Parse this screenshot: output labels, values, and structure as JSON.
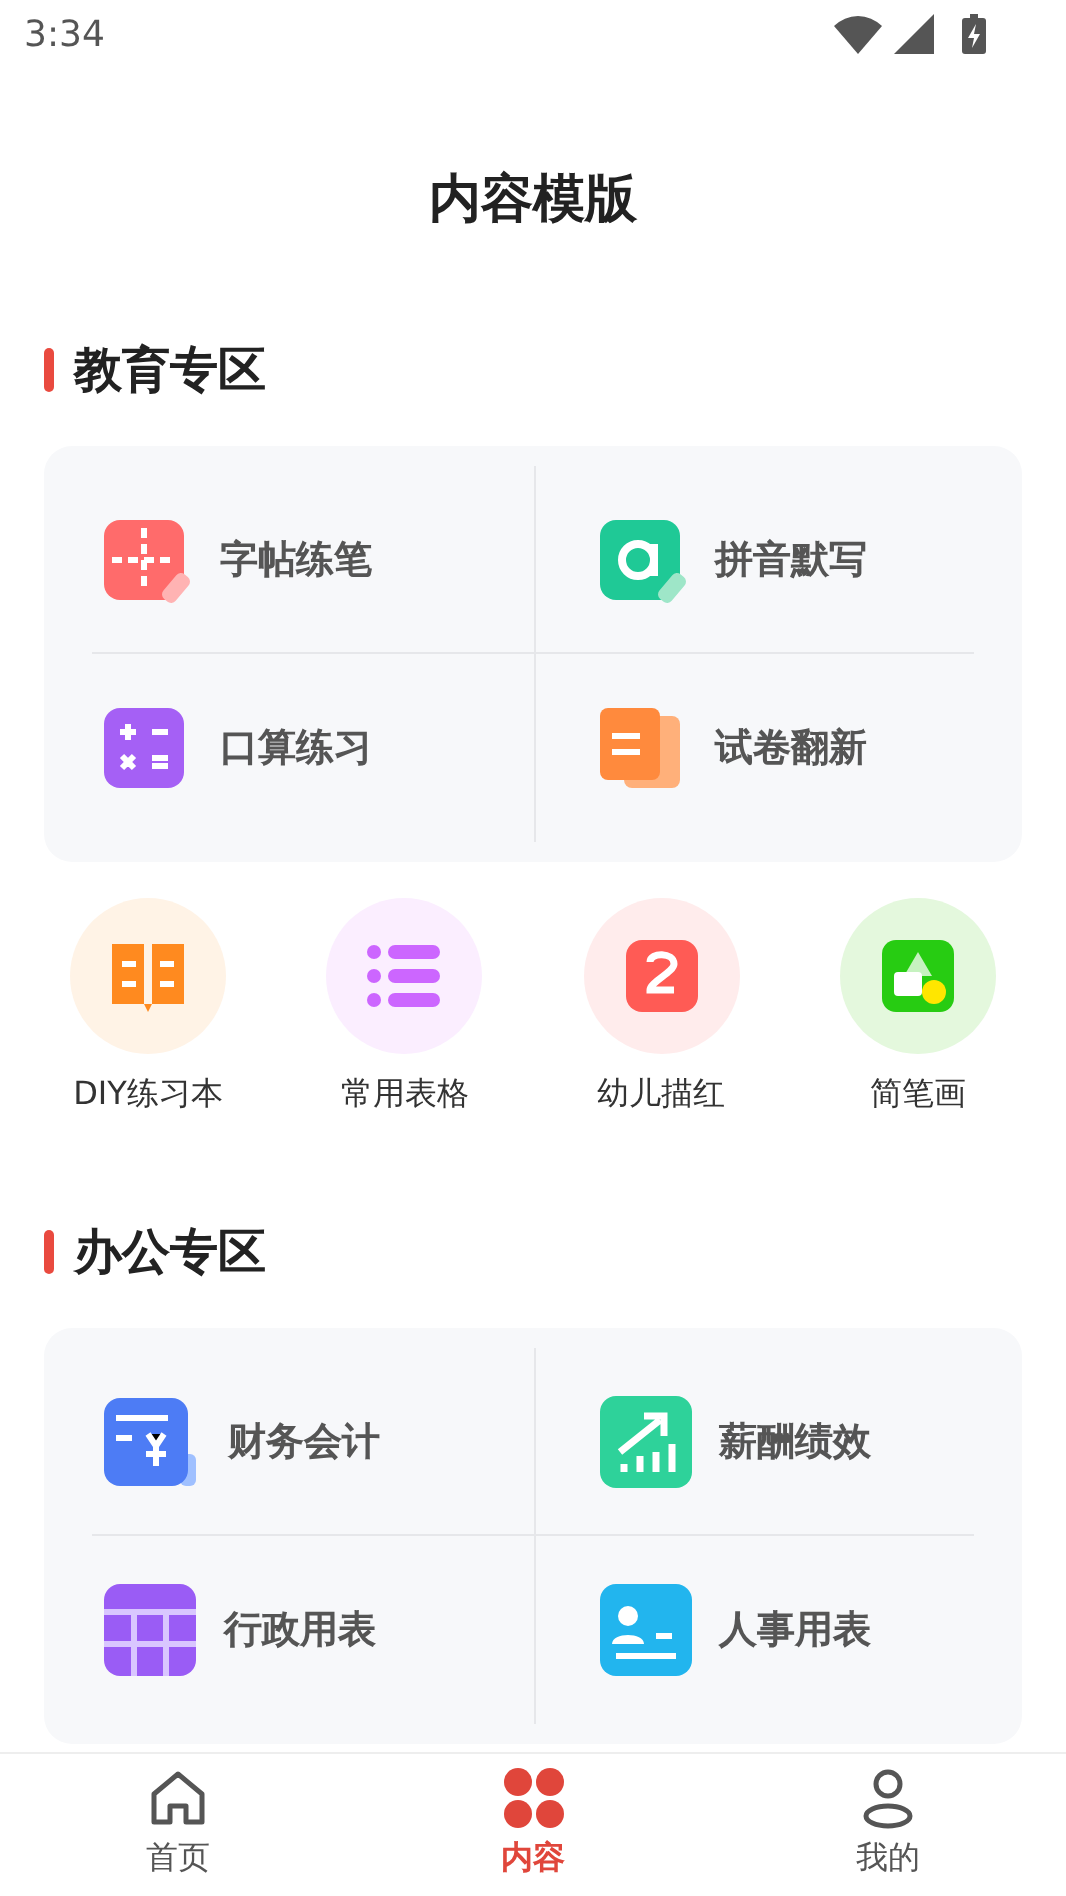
{
  "status_bar": {
    "time": "3:34"
  },
  "header": {
    "title": "内容模版"
  },
  "sections": [
    {
      "title": "教育专区",
      "grid": [
        "字帖练笔",
        "拼音默写",
        "口算练习",
        "试卷翻新"
      ],
      "shortcuts": [
        "DIY练习本",
        "常用表格",
        "幼儿描红",
        "简笔画"
      ]
    },
    {
      "title": "办公专区",
      "grid": [
        "财务会计",
        "薪酬绩效",
        "行政用表",
        "人事用表"
      ]
    }
  ],
  "tab_bar": [
    {
      "label": "首页",
      "selected": false
    },
    {
      "label": "内容",
      "selected": true
    },
    {
      "label": "我的",
      "selected": false
    }
  ]
}
